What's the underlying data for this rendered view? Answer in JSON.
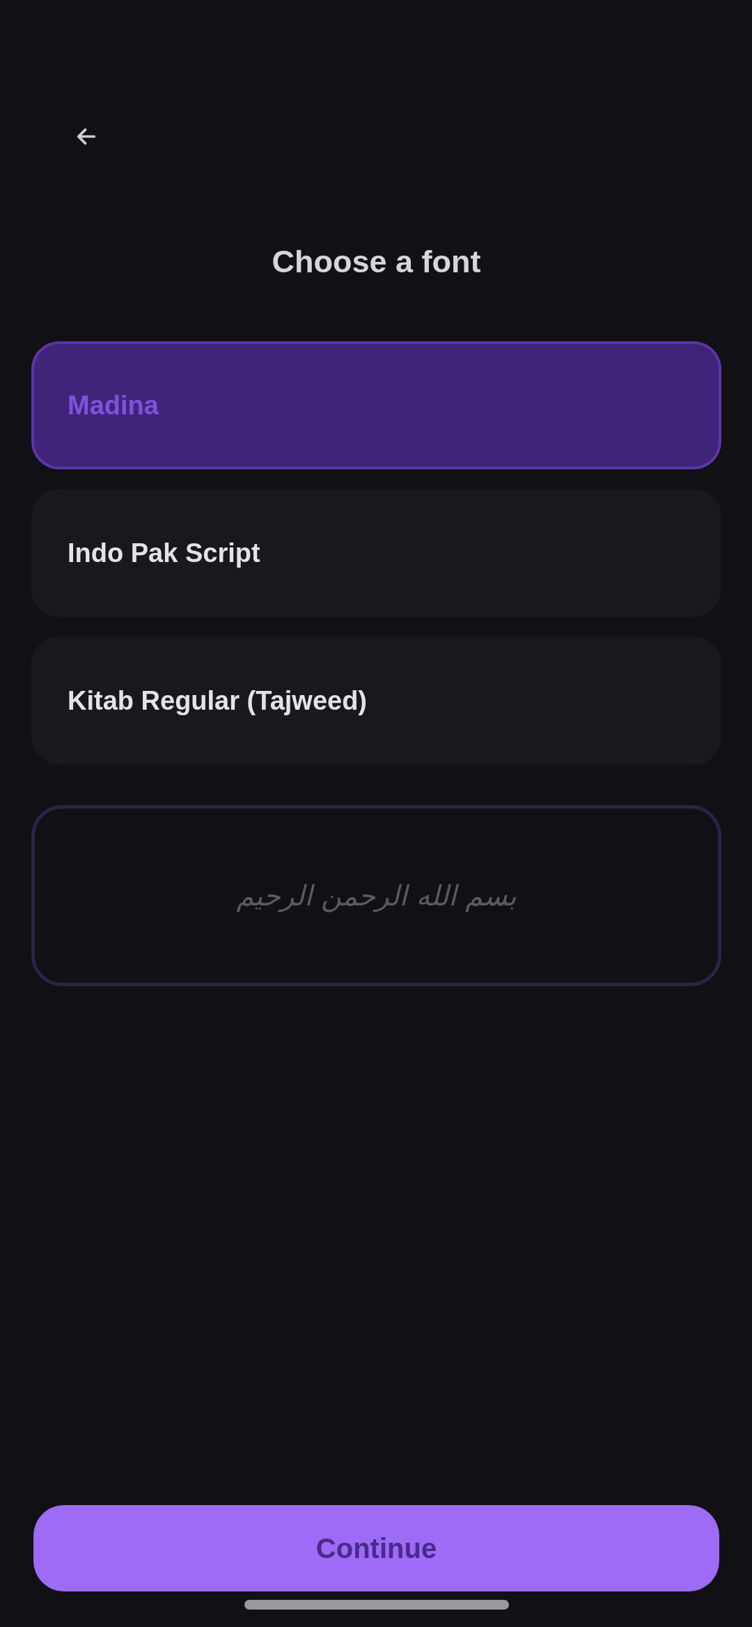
{
  "header": {
    "title": "Choose a font"
  },
  "fonts": [
    {
      "label": "Madina",
      "selected": true
    },
    {
      "label": "Indo Pak Script",
      "selected": false
    },
    {
      "label": "Kitab Regular (Tajweed)",
      "selected": false
    }
  ],
  "preview": {
    "text": "بسم الله الرحمن الرحيم"
  },
  "continue_button": {
    "label": "Continue"
  }
}
